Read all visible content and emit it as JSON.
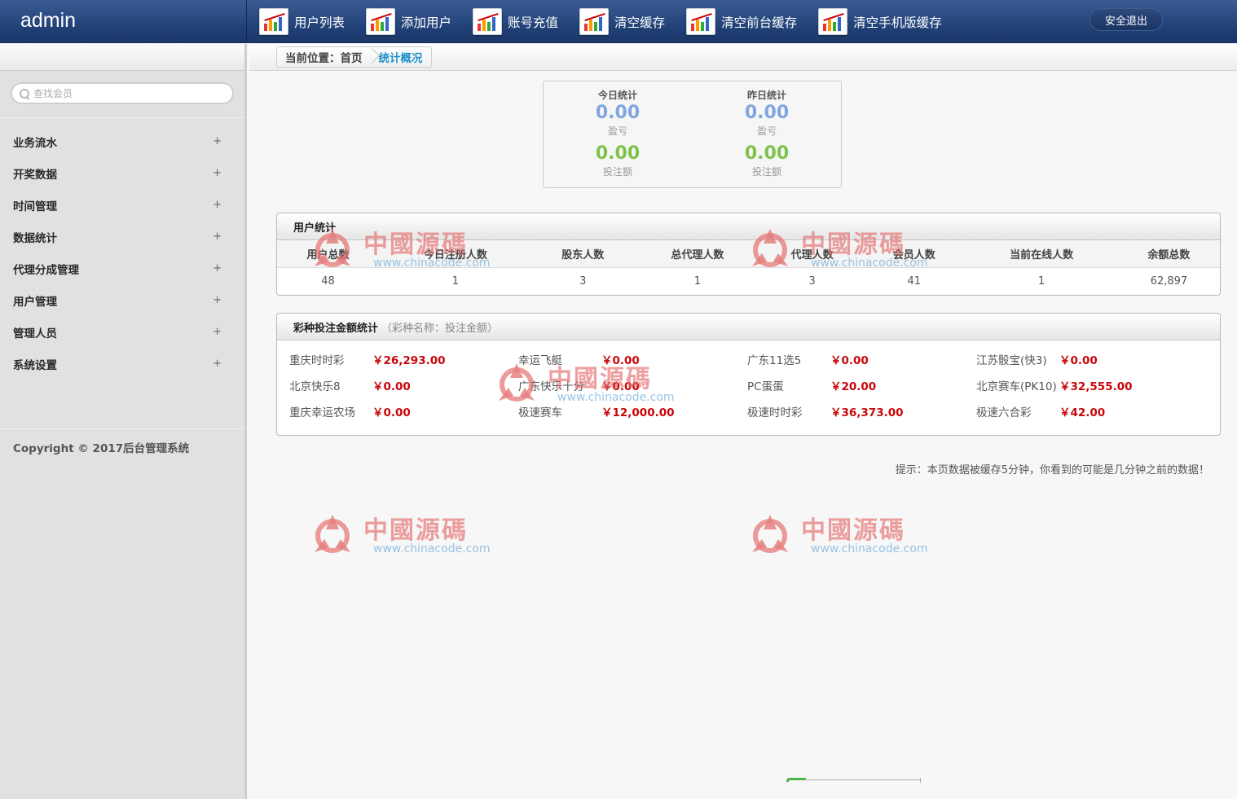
{
  "header": {
    "brand": "admin",
    "nav": [
      "用户列表",
      "添加用户",
      "账号充值",
      "清空缓存",
      "清空前台缓存",
      "清空手机版缓存"
    ],
    "logout": "安全退出"
  },
  "sidebar": {
    "search_placeholder": "查找会员",
    "items": [
      "业务流水",
      "开奖数据",
      "时间管理",
      "数据统计",
      "代理分成管理",
      "用户管理",
      "管理人员",
      "系统设置"
    ],
    "expand_symbol": "+",
    "copyright": "Copyright © 2017后台管理系统"
  },
  "breadcrumb": {
    "label": "当前位置：",
    "home": "首页",
    "current": "统计概况"
  },
  "stats": {
    "today": {
      "title": "今日统计",
      "profit": "0.00",
      "profit_label": "盈亏",
      "bet": "0.00",
      "bet_label": "投注额"
    },
    "yesterday": {
      "title": "昨日统计",
      "profit": "0.00",
      "profit_label": "盈亏",
      "bet": "0.00",
      "bet_label": "投注额"
    }
  },
  "user_stats": {
    "title": "用户统计",
    "headers": [
      "用户总数",
      "今日注册人数",
      "股东人数",
      "总代理人数",
      "代理人数",
      "会员人数",
      "当前在线人数",
      "余额总数"
    ],
    "values": [
      "48",
      "1",
      "3",
      "1",
      "3",
      "41",
      "1",
      "62,897"
    ]
  },
  "lottery": {
    "title": "彩种投注金额统计",
    "hint": "（彩种名称：投注金额）",
    "rows": [
      [
        [
          "重庆时时彩",
          "￥26,293.00"
        ],
        [
          "幸运飞艇",
          "￥0.00"
        ],
        [
          "广东11选5",
          "￥0.00"
        ],
        [
          "江苏骰宝(快3)",
          "￥0.00"
        ]
      ],
      [
        [
          "北京快乐8",
          "￥0.00"
        ],
        [
          "广东快乐十分",
          "￥0.00"
        ],
        [
          "PC蛋蛋",
          "￥20.00"
        ],
        [
          "北京赛车(PK10)",
          "￥32,555.00"
        ]
      ],
      [
        [
          "重庆幸运农场",
          "￥0.00"
        ],
        [
          "极速赛车",
          "￥12,000.00"
        ],
        [
          "极速时时彩",
          "￥36,373.00"
        ],
        [
          "极速六合彩",
          "￥42.00"
        ]
      ]
    ]
  },
  "tip": "提示：本页数据被缓存5分钟，你看到的可能是几分钟之前的数据！",
  "watermark": {
    "cn": "中國源碼",
    "url": "www.chinacode.com"
  },
  "colors": {
    "header": "#1f3f75",
    "accent": "#1e8fc9",
    "money": "#c8070a",
    "profit": "#7ea6e0",
    "bet": "#7dc34a"
  }
}
